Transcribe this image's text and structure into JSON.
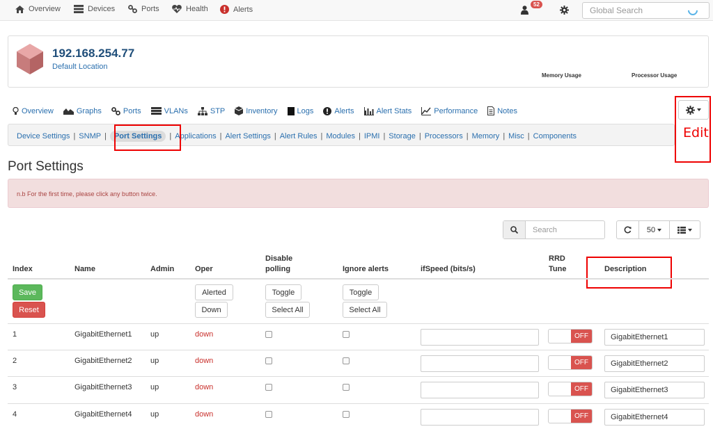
{
  "topnav": {
    "items": [
      {
        "label": "Overview",
        "icon": "home-icon"
      },
      {
        "label": "Devices",
        "icon": "server-icon"
      },
      {
        "label": "Ports",
        "icon": "link-icon"
      },
      {
        "label": "Health",
        "icon": "heartbeat-icon"
      },
      {
        "label": "Alerts",
        "icon": "exclamation-circle-icon"
      }
    ],
    "notification_count": "52",
    "search_placeholder": "Global Search"
  },
  "device": {
    "ip": "192.168.254.77",
    "location": "Default Location",
    "memory_label": "Memory Usage",
    "processor_label": "Processor Usage"
  },
  "device_tabs": [
    {
      "label": "Overview",
      "icon": "lightbulb-icon"
    },
    {
      "label": "Graphs",
      "icon": "area-chart-icon"
    },
    {
      "label": "Ports",
      "icon": "link-icon"
    },
    {
      "label": "VLANs",
      "icon": "tasks-icon"
    },
    {
      "label": "STP",
      "icon": "sitemap-icon"
    },
    {
      "label": "Inventory",
      "icon": "cube-icon"
    },
    {
      "label": "Logs",
      "icon": "book-icon"
    },
    {
      "label": "Alerts",
      "icon": "exclamation-circle-icon"
    },
    {
      "label": "Alert Stats",
      "icon": "bar-chart-icon"
    },
    {
      "label": "Performance",
      "icon": "line-chart-icon"
    },
    {
      "label": "Notes",
      "icon": "file-text-icon"
    }
  ],
  "annotation": {
    "edit_label": "Edit"
  },
  "subnav": [
    "Device Settings",
    "SNMP",
    "Port Settings",
    "Applications",
    "Alert Settings",
    "Alert Rules",
    "Modules",
    "IPMI",
    "Storage",
    "Processors",
    "Memory",
    "Misc",
    "Components"
  ],
  "page": {
    "title": "Port Settings",
    "notice": "n.b For the first time, please click any button twice."
  },
  "toolbar": {
    "search_placeholder": "Search",
    "page_size": "50"
  },
  "table": {
    "headers": {
      "index": "Index",
      "name": "Name",
      "admin": "Admin",
      "oper": "Oper",
      "disable_polling_1": "Disable",
      "disable_polling_2": "polling",
      "ignore_alerts": "Ignore alerts",
      "ifspeed": "ifSpeed (bits/s)",
      "rrd_1": "RRD",
      "rrd_2": "Tune",
      "description": "Description"
    },
    "buttons": {
      "save": "Save",
      "reset": "Reset",
      "alerted": "Alerted",
      "down": "Down",
      "toggle_polling": "Toggle",
      "select_all_polling": "Select All",
      "toggle_alerts": "Toggle",
      "select_all_alerts": "Select All"
    },
    "rows": [
      {
        "index": "1",
        "name": "GigabitEthernet1",
        "admin": "up",
        "oper": "down",
        "rrd": "OFF",
        "description": "GigabitEthernet1"
      },
      {
        "index": "2",
        "name": "GigabitEthernet2",
        "admin": "up",
        "oper": "down",
        "rrd": "OFF",
        "description": "GigabitEthernet2"
      },
      {
        "index": "3",
        "name": "GigabitEthernet3",
        "admin": "up",
        "oper": "down",
        "rrd": "OFF",
        "description": "GigabitEthernet3"
      },
      {
        "index": "4",
        "name": "GigabitEthernet4",
        "admin": "up",
        "oper": "down",
        "rrd": "OFF",
        "description": "GigabitEthernet4"
      }
    ]
  }
}
